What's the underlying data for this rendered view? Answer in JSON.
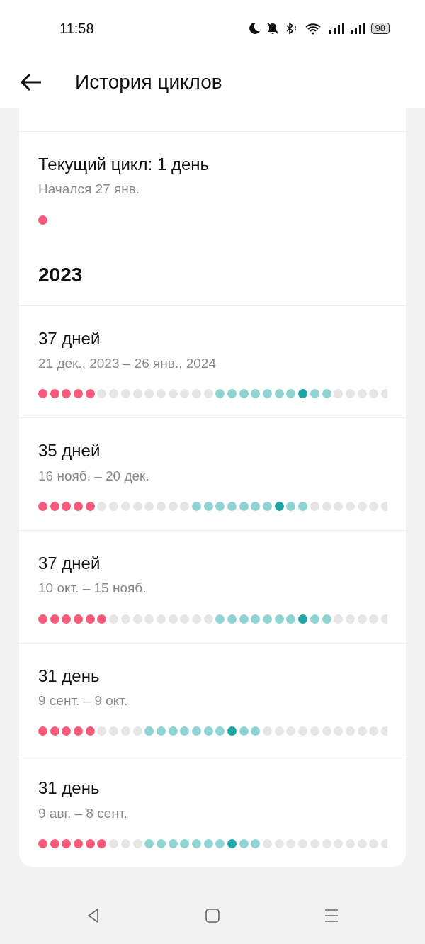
{
  "status_bar": {
    "time": "11:58",
    "battery": "98"
  },
  "header": {
    "title": "История циклов"
  },
  "sections": [
    {
      "cycles": [
        {
          "title": "Текущий цикл: 1 день",
          "dates": "Начался 27 янв.",
          "days": [
            {
              "kind": "period"
            }
          ]
        }
      ]
    },
    {
      "year": "2023",
      "cycles": [
        {
          "title": "37 дней",
          "dates": "21 дек., 2023 – 26 янв., 2024",
          "days": [
            {
              "kind": "period"
            },
            {
              "kind": "period"
            },
            {
              "kind": "period"
            },
            {
              "kind": "period"
            },
            {
              "kind": "period"
            },
            {
              "kind": "none"
            },
            {
              "kind": "none"
            },
            {
              "kind": "none"
            },
            {
              "kind": "none"
            },
            {
              "kind": "none"
            },
            {
              "kind": "none"
            },
            {
              "kind": "none"
            },
            {
              "kind": "none"
            },
            {
              "kind": "none"
            },
            {
              "kind": "none"
            },
            {
              "kind": "fertile"
            },
            {
              "kind": "fertile"
            },
            {
              "kind": "fertile"
            },
            {
              "kind": "fertile"
            },
            {
              "kind": "fertile"
            },
            {
              "kind": "fertile"
            },
            {
              "kind": "fertile"
            },
            {
              "kind": "ovulation"
            },
            {
              "kind": "fertile"
            },
            {
              "kind": "fertile"
            },
            {
              "kind": "none"
            },
            {
              "kind": "none"
            },
            {
              "kind": "none"
            },
            {
              "kind": "none"
            },
            {
              "kind": "none"
            }
          ]
        },
        {
          "title": "35 дней",
          "dates": "16 нояб. – 20 дек.",
          "days": [
            {
              "kind": "period"
            },
            {
              "kind": "period"
            },
            {
              "kind": "period"
            },
            {
              "kind": "period"
            },
            {
              "kind": "period"
            },
            {
              "kind": "none"
            },
            {
              "kind": "none"
            },
            {
              "kind": "none"
            },
            {
              "kind": "none"
            },
            {
              "kind": "none"
            },
            {
              "kind": "none"
            },
            {
              "kind": "none"
            },
            {
              "kind": "none"
            },
            {
              "kind": "fertile"
            },
            {
              "kind": "fertile"
            },
            {
              "kind": "fertile"
            },
            {
              "kind": "fertile"
            },
            {
              "kind": "fertile"
            },
            {
              "kind": "fertile"
            },
            {
              "kind": "fertile"
            },
            {
              "kind": "ovulation"
            },
            {
              "kind": "fertile"
            },
            {
              "kind": "fertile"
            },
            {
              "kind": "none"
            },
            {
              "kind": "none"
            },
            {
              "kind": "none"
            },
            {
              "kind": "none"
            },
            {
              "kind": "none"
            },
            {
              "kind": "none"
            },
            {
              "kind": "none"
            }
          ]
        },
        {
          "title": "37 дней",
          "dates": "10 окт. – 15 нояб.",
          "days": [
            {
              "kind": "period"
            },
            {
              "kind": "period"
            },
            {
              "kind": "period"
            },
            {
              "kind": "period"
            },
            {
              "kind": "period"
            },
            {
              "kind": "period"
            },
            {
              "kind": "none"
            },
            {
              "kind": "none"
            },
            {
              "kind": "none"
            },
            {
              "kind": "none"
            },
            {
              "kind": "none"
            },
            {
              "kind": "none"
            },
            {
              "kind": "none"
            },
            {
              "kind": "none"
            },
            {
              "kind": "none"
            },
            {
              "kind": "fertile"
            },
            {
              "kind": "fertile"
            },
            {
              "kind": "fertile"
            },
            {
              "kind": "fertile"
            },
            {
              "kind": "fertile"
            },
            {
              "kind": "fertile"
            },
            {
              "kind": "fertile"
            },
            {
              "kind": "ovulation"
            },
            {
              "kind": "fertile"
            },
            {
              "kind": "fertile"
            },
            {
              "kind": "none"
            },
            {
              "kind": "none"
            },
            {
              "kind": "none"
            },
            {
              "kind": "none"
            },
            {
              "kind": "none"
            }
          ]
        },
        {
          "title": "31 день",
          "dates": "9 сент. – 9 окт.",
          "days": [
            {
              "kind": "period"
            },
            {
              "kind": "period"
            },
            {
              "kind": "period"
            },
            {
              "kind": "period"
            },
            {
              "kind": "period"
            },
            {
              "kind": "none"
            },
            {
              "kind": "none"
            },
            {
              "kind": "none"
            },
            {
              "kind": "none"
            },
            {
              "kind": "fertile"
            },
            {
              "kind": "fertile"
            },
            {
              "kind": "fertile"
            },
            {
              "kind": "fertile"
            },
            {
              "kind": "fertile"
            },
            {
              "kind": "fertile"
            },
            {
              "kind": "fertile"
            },
            {
              "kind": "ovulation"
            },
            {
              "kind": "fertile"
            },
            {
              "kind": "fertile"
            },
            {
              "kind": "none"
            },
            {
              "kind": "none"
            },
            {
              "kind": "none"
            },
            {
              "kind": "none"
            },
            {
              "kind": "none"
            },
            {
              "kind": "none"
            },
            {
              "kind": "none"
            },
            {
              "kind": "none"
            },
            {
              "kind": "none"
            },
            {
              "kind": "none"
            },
            {
              "kind": "none"
            }
          ]
        },
        {
          "title": "31 день",
          "dates": "9 авг. – 8 сент.",
          "days": [
            {
              "kind": "period"
            },
            {
              "kind": "period"
            },
            {
              "kind": "period"
            },
            {
              "kind": "period"
            },
            {
              "kind": "period"
            },
            {
              "kind": "period"
            },
            {
              "kind": "none"
            },
            {
              "kind": "none"
            },
            {
              "kind": "none"
            },
            {
              "kind": "fertile"
            },
            {
              "kind": "fertile"
            },
            {
              "kind": "fertile"
            },
            {
              "kind": "fertile"
            },
            {
              "kind": "fertile"
            },
            {
              "kind": "fertile"
            },
            {
              "kind": "fertile"
            },
            {
              "kind": "ovulation"
            },
            {
              "kind": "fertile"
            },
            {
              "kind": "fertile"
            },
            {
              "kind": "none"
            },
            {
              "kind": "none"
            },
            {
              "kind": "none"
            },
            {
              "kind": "none"
            },
            {
              "kind": "none"
            },
            {
              "kind": "none"
            },
            {
              "kind": "none"
            },
            {
              "kind": "none"
            },
            {
              "kind": "none"
            },
            {
              "kind": "none"
            },
            {
              "kind": "none"
            }
          ]
        }
      ]
    }
  ]
}
